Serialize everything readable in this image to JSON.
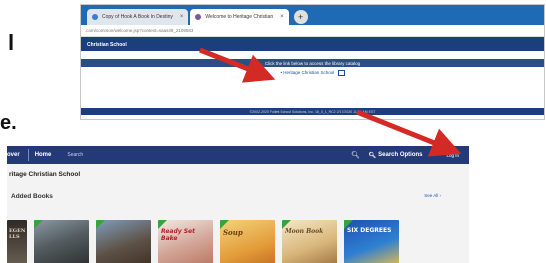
{
  "slide_fragments": {
    "left_glyph": "l",
    "left_sentence_end": "e."
  },
  "browser": {
    "tabs": [
      {
        "label": "Copy of Hook A Book In Destiny"
      },
      {
        "label": "Welcome to Heritage Christian"
      }
    ],
    "address": ".com/common/welcome.jsp?context=saas49_2109583",
    "site_banner": "Christian School",
    "instruction": "Click the link below to access the library catalog",
    "catalog_link": "Heritage Christian School",
    "footer": "©2002-2020 Follett School Solutions, Inc. 18_0_1_RC2  2/17/2020 11:45 AM EST"
  },
  "app": {
    "nav": {
      "discover": "over",
      "home": "Home",
      "search": "Search",
      "search_options": "Search Options",
      "login": "Log In"
    },
    "school_title": "ritage Christian School",
    "row_title": "Added Books",
    "see_all": "See All ›",
    "covers": [
      {
        "title": "EGEN LLS"
      },
      {
        "title": ""
      },
      {
        "title": ""
      },
      {
        "title": "Ready Set Bake"
      },
      {
        "title": "Soup"
      },
      {
        "title": "Moon Book"
      },
      {
        "title": "SIX DEGREES"
      }
    ]
  },
  "colors": {
    "arrow": "#d42a26",
    "nav": "#243a78",
    "banner": "#1b3f7a",
    "tabbar": "#1f6ab5"
  }
}
